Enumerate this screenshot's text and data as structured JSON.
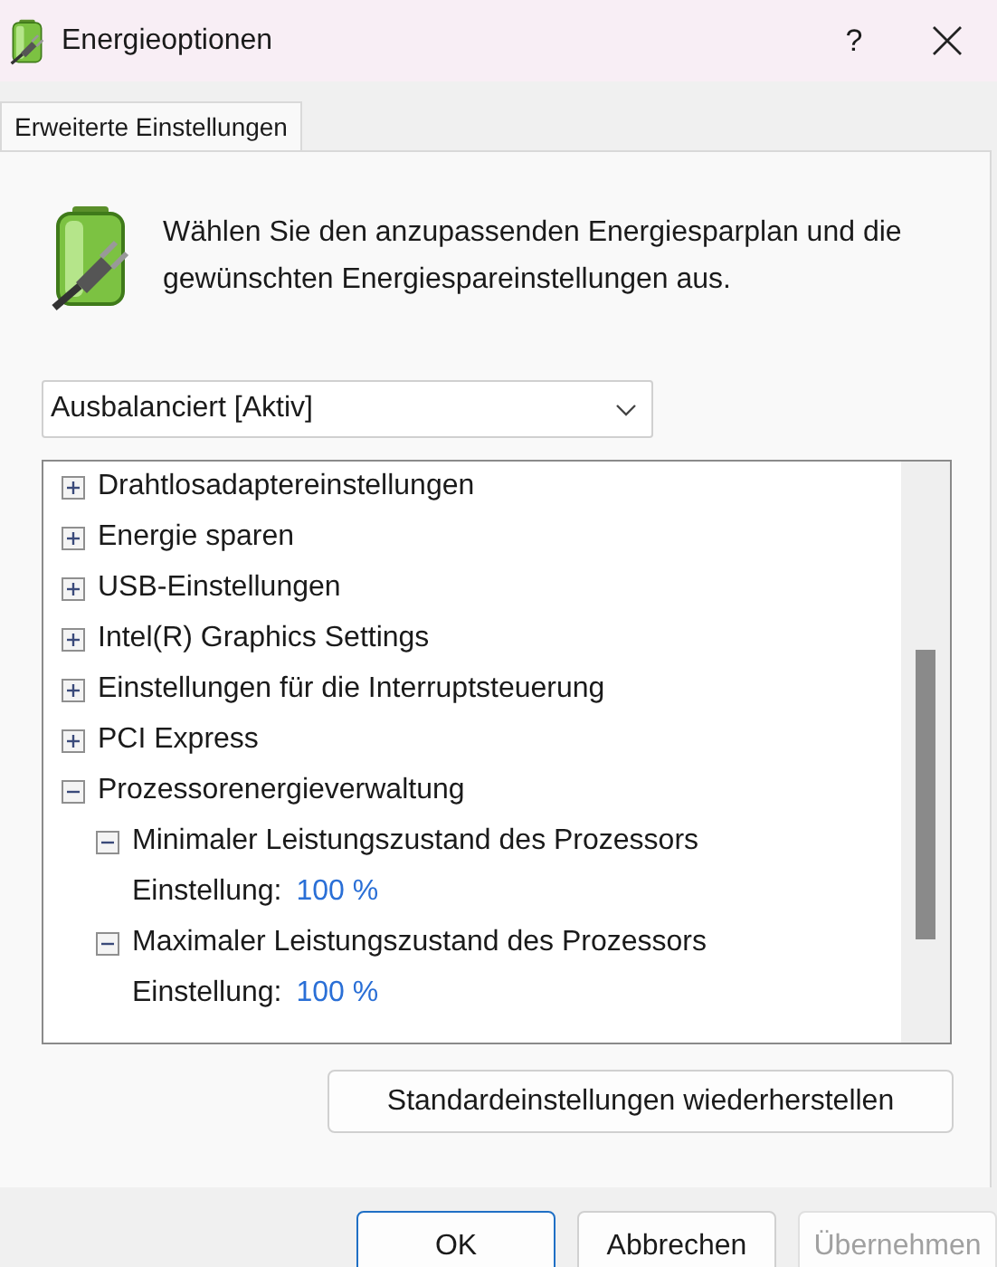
{
  "window": {
    "title": "Energieoptionen",
    "help": "?"
  },
  "tabs": [
    {
      "label": "Erweiterte Einstellungen",
      "selected": true
    }
  ],
  "intro": "Wählen Sie den anzupassenden Energiesparplan und die gewünschten Energiespareinstellungen aus.",
  "plan_select": {
    "value": "Ausbalanciert [Aktiv]"
  },
  "tree": [
    {
      "kind": "group",
      "label": "Drahtlosadaptereinstellungen",
      "expanded": false
    },
    {
      "kind": "group",
      "label": "Energie sparen",
      "expanded": false
    },
    {
      "kind": "group",
      "label": "USB-Einstellungen",
      "expanded": false
    },
    {
      "kind": "group",
      "label": "Intel(R) Graphics Settings",
      "expanded": false
    },
    {
      "kind": "group",
      "label": "Einstellungen für die Interruptsteuerung",
      "expanded": false
    },
    {
      "kind": "group",
      "label": "PCI Express",
      "expanded": false
    },
    {
      "kind": "group",
      "label": "Prozessorenergieverwaltung",
      "expanded": true,
      "children": [
        {
          "kind": "group",
          "label": "Minimaler Leistungszustand des Prozessors",
          "expanded": true,
          "children": [
            {
              "kind": "setting",
              "label": "Einstellung:",
              "value": "100 %"
            }
          ]
        },
        {
          "kind": "group",
          "label": "Maximaler Leistungszustand des Prozessors",
          "expanded": true,
          "children": [
            {
              "kind": "setting",
              "label": "Einstellung:",
              "value": "100 %"
            }
          ]
        }
      ]
    }
  ],
  "restore_button": "Standardeinstellungen wiederherstellen",
  "buttons": [
    {
      "label": "OK",
      "default": true,
      "disabled": false
    },
    {
      "label": "Abbrechen",
      "default": false,
      "disabled": false
    },
    {
      "label": "Übernehmen",
      "default": false,
      "disabled": true
    }
  ]
}
